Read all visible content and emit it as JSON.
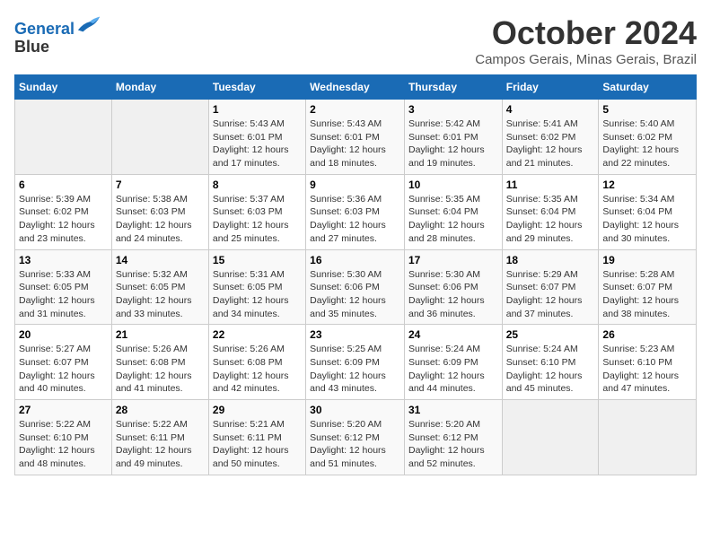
{
  "header": {
    "logo_line1": "General",
    "logo_line2": "Blue",
    "month": "October 2024",
    "location": "Campos Gerais, Minas Gerais, Brazil"
  },
  "weekdays": [
    "Sunday",
    "Monday",
    "Tuesday",
    "Wednesday",
    "Thursday",
    "Friday",
    "Saturday"
  ],
  "weeks": [
    [
      {
        "num": "",
        "sunrise": "",
        "sunset": "",
        "daylight": ""
      },
      {
        "num": "",
        "sunrise": "",
        "sunset": "",
        "daylight": ""
      },
      {
        "num": "1",
        "sunrise": "Sunrise: 5:43 AM",
        "sunset": "Sunset: 6:01 PM",
        "daylight": "Daylight: 12 hours and 17 minutes."
      },
      {
        "num": "2",
        "sunrise": "Sunrise: 5:43 AM",
        "sunset": "Sunset: 6:01 PM",
        "daylight": "Daylight: 12 hours and 18 minutes."
      },
      {
        "num": "3",
        "sunrise": "Sunrise: 5:42 AM",
        "sunset": "Sunset: 6:01 PM",
        "daylight": "Daylight: 12 hours and 19 minutes."
      },
      {
        "num": "4",
        "sunrise": "Sunrise: 5:41 AM",
        "sunset": "Sunset: 6:02 PM",
        "daylight": "Daylight: 12 hours and 21 minutes."
      },
      {
        "num": "5",
        "sunrise": "Sunrise: 5:40 AM",
        "sunset": "Sunset: 6:02 PM",
        "daylight": "Daylight: 12 hours and 22 minutes."
      }
    ],
    [
      {
        "num": "6",
        "sunrise": "Sunrise: 5:39 AM",
        "sunset": "Sunset: 6:02 PM",
        "daylight": "Daylight: 12 hours and 23 minutes."
      },
      {
        "num": "7",
        "sunrise": "Sunrise: 5:38 AM",
        "sunset": "Sunset: 6:03 PM",
        "daylight": "Daylight: 12 hours and 24 minutes."
      },
      {
        "num": "8",
        "sunrise": "Sunrise: 5:37 AM",
        "sunset": "Sunset: 6:03 PM",
        "daylight": "Daylight: 12 hours and 25 minutes."
      },
      {
        "num": "9",
        "sunrise": "Sunrise: 5:36 AM",
        "sunset": "Sunset: 6:03 PM",
        "daylight": "Daylight: 12 hours and 27 minutes."
      },
      {
        "num": "10",
        "sunrise": "Sunrise: 5:35 AM",
        "sunset": "Sunset: 6:04 PM",
        "daylight": "Daylight: 12 hours and 28 minutes."
      },
      {
        "num": "11",
        "sunrise": "Sunrise: 5:35 AM",
        "sunset": "Sunset: 6:04 PM",
        "daylight": "Daylight: 12 hours and 29 minutes."
      },
      {
        "num": "12",
        "sunrise": "Sunrise: 5:34 AM",
        "sunset": "Sunset: 6:04 PM",
        "daylight": "Daylight: 12 hours and 30 minutes."
      }
    ],
    [
      {
        "num": "13",
        "sunrise": "Sunrise: 5:33 AM",
        "sunset": "Sunset: 6:05 PM",
        "daylight": "Daylight: 12 hours and 31 minutes."
      },
      {
        "num": "14",
        "sunrise": "Sunrise: 5:32 AM",
        "sunset": "Sunset: 6:05 PM",
        "daylight": "Daylight: 12 hours and 33 minutes."
      },
      {
        "num": "15",
        "sunrise": "Sunrise: 5:31 AM",
        "sunset": "Sunset: 6:05 PM",
        "daylight": "Daylight: 12 hours and 34 minutes."
      },
      {
        "num": "16",
        "sunrise": "Sunrise: 5:30 AM",
        "sunset": "Sunset: 6:06 PM",
        "daylight": "Daylight: 12 hours and 35 minutes."
      },
      {
        "num": "17",
        "sunrise": "Sunrise: 5:30 AM",
        "sunset": "Sunset: 6:06 PM",
        "daylight": "Daylight: 12 hours and 36 minutes."
      },
      {
        "num": "18",
        "sunrise": "Sunrise: 5:29 AM",
        "sunset": "Sunset: 6:07 PM",
        "daylight": "Daylight: 12 hours and 37 minutes."
      },
      {
        "num": "19",
        "sunrise": "Sunrise: 5:28 AM",
        "sunset": "Sunset: 6:07 PM",
        "daylight": "Daylight: 12 hours and 38 minutes."
      }
    ],
    [
      {
        "num": "20",
        "sunrise": "Sunrise: 5:27 AM",
        "sunset": "Sunset: 6:07 PM",
        "daylight": "Daylight: 12 hours and 40 minutes."
      },
      {
        "num": "21",
        "sunrise": "Sunrise: 5:26 AM",
        "sunset": "Sunset: 6:08 PM",
        "daylight": "Daylight: 12 hours and 41 minutes."
      },
      {
        "num": "22",
        "sunrise": "Sunrise: 5:26 AM",
        "sunset": "Sunset: 6:08 PM",
        "daylight": "Daylight: 12 hours and 42 minutes."
      },
      {
        "num": "23",
        "sunrise": "Sunrise: 5:25 AM",
        "sunset": "Sunset: 6:09 PM",
        "daylight": "Daylight: 12 hours and 43 minutes."
      },
      {
        "num": "24",
        "sunrise": "Sunrise: 5:24 AM",
        "sunset": "Sunset: 6:09 PM",
        "daylight": "Daylight: 12 hours and 44 minutes."
      },
      {
        "num": "25",
        "sunrise": "Sunrise: 5:24 AM",
        "sunset": "Sunset: 6:10 PM",
        "daylight": "Daylight: 12 hours and 45 minutes."
      },
      {
        "num": "26",
        "sunrise": "Sunrise: 5:23 AM",
        "sunset": "Sunset: 6:10 PM",
        "daylight": "Daylight: 12 hours and 47 minutes."
      }
    ],
    [
      {
        "num": "27",
        "sunrise": "Sunrise: 5:22 AM",
        "sunset": "Sunset: 6:10 PM",
        "daylight": "Daylight: 12 hours and 48 minutes."
      },
      {
        "num": "28",
        "sunrise": "Sunrise: 5:22 AM",
        "sunset": "Sunset: 6:11 PM",
        "daylight": "Daylight: 12 hours and 49 minutes."
      },
      {
        "num": "29",
        "sunrise": "Sunrise: 5:21 AM",
        "sunset": "Sunset: 6:11 PM",
        "daylight": "Daylight: 12 hours and 50 minutes."
      },
      {
        "num": "30",
        "sunrise": "Sunrise: 5:20 AM",
        "sunset": "Sunset: 6:12 PM",
        "daylight": "Daylight: 12 hours and 51 minutes."
      },
      {
        "num": "31",
        "sunrise": "Sunrise: 5:20 AM",
        "sunset": "Sunset: 6:12 PM",
        "daylight": "Daylight: 12 hours and 52 minutes."
      },
      {
        "num": "",
        "sunrise": "",
        "sunset": "",
        "daylight": ""
      },
      {
        "num": "",
        "sunrise": "",
        "sunset": "",
        "daylight": ""
      }
    ]
  ]
}
